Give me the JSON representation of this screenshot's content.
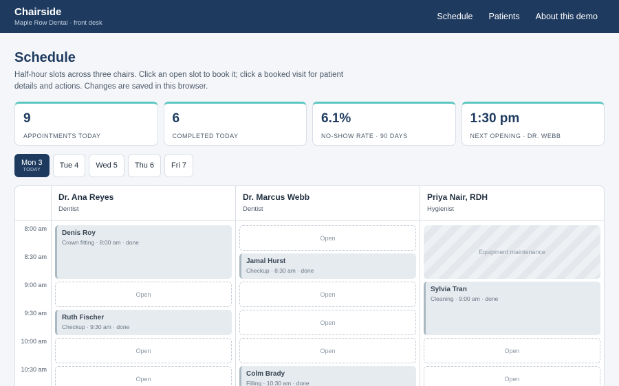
{
  "app": {
    "title": "Chairside",
    "subtitle": "Maple Row Dental · front desk"
  },
  "nav": [
    "Schedule",
    "Patients",
    "About this demo"
  ],
  "page": {
    "title": "Schedule",
    "description": "Half-hour slots across three chairs. Click an open slot to book it; click a booked visit for patient details and actions. Changes are saved in this browser."
  },
  "stats": [
    {
      "value": "9",
      "label": "APPOINTMENTS TODAY"
    },
    {
      "value": "6",
      "label": "COMPLETED TODAY"
    },
    {
      "value": "6.1%",
      "label": "NO-SHOW RATE · 90 DAYS"
    },
    {
      "value": "1:30 pm",
      "label": "NEXT OPENING · DR. WEBB"
    }
  ],
  "days": [
    {
      "label": "Mon 3",
      "sub": "TODAY",
      "active": true
    },
    {
      "label": "Tue 4"
    },
    {
      "label": "Wed 5"
    },
    {
      "label": "Thu 6"
    },
    {
      "label": "Fri 7"
    }
  ],
  "times": [
    "8:00 am",
    "8:30 am",
    "9:00 am",
    "9:30 am",
    "10:00 am",
    "10:30 am"
  ],
  "chairs": [
    {
      "name": "Dr. Ana Reyes",
      "role": "Dentist",
      "slots": [
        {
          "type": "booked",
          "start": 0,
          "span": 2,
          "patient": "Denis Roy",
          "detail": "Crown fitting · 8:00 am · done"
        },
        {
          "type": "open",
          "start": 2,
          "span": 1,
          "label": "Open"
        },
        {
          "type": "booked",
          "start": 3,
          "span": 1,
          "patient": "Ruth Fischer",
          "detail": "Checkup · 9:30 am · done"
        },
        {
          "type": "open",
          "start": 4,
          "span": 1,
          "label": "Open"
        },
        {
          "type": "open",
          "start": 5,
          "span": 1,
          "label": "Open"
        }
      ]
    },
    {
      "name": "Dr. Marcus Webb",
      "role": "Dentist",
      "slots": [
        {
          "type": "open",
          "start": 0,
          "span": 1,
          "label": "Open"
        },
        {
          "type": "booked",
          "start": 1,
          "span": 1,
          "patient": "Jamal Hurst",
          "detail": "Checkup · 8:30 am · done"
        },
        {
          "type": "open",
          "start": 2,
          "span": 1,
          "label": "Open"
        },
        {
          "type": "open",
          "start": 3,
          "span": 1,
          "label": "Open"
        },
        {
          "type": "open",
          "start": 4,
          "span": 1,
          "label": "Open"
        },
        {
          "type": "booked",
          "start": 5,
          "span": 1,
          "patient": "Colm Brady",
          "detail": "Filling · 10:30 am · done"
        }
      ]
    },
    {
      "name": "Priya Nair, RDH",
      "role": "Hygienist",
      "slots": [
        {
          "type": "blocked",
          "start": 0,
          "span": 2,
          "label": "Equipment maintenance"
        },
        {
          "type": "booked",
          "start": 2,
          "span": 2,
          "patient": "Sylvia Tran",
          "detail": "Cleaning · 9:00 am · done"
        },
        {
          "type": "open",
          "start": 4,
          "span": 1,
          "label": "Open"
        },
        {
          "type": "open",
          "start": 5,
          "span": 1,
          "label": "Open"
        }
      ]
    }
  ]
}
